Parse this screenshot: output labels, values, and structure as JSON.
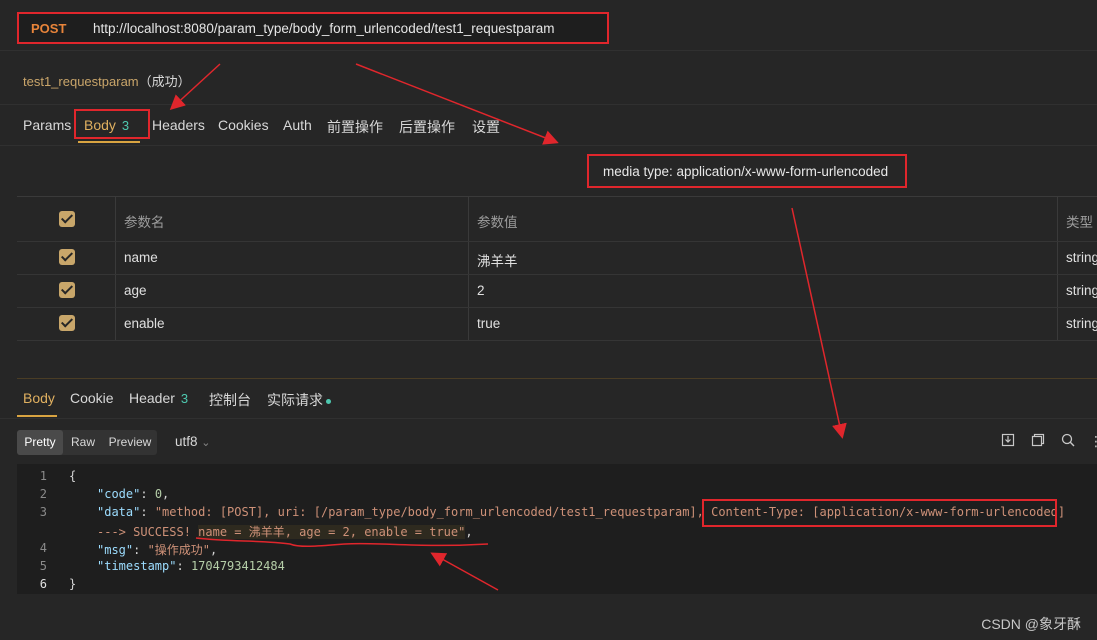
{
  "request": {
    "method": "POST",
    "url": "http://localhost:8080/param_type/body_form_urlencoded/test1_requestparam",
    "name": "test1_requestparam",
    "status": "（成功）"
  },
  "tabs": [
    {
      "label": "Params"
    },
    {
      "label": "Body",
      "count": "3"
    },
    {
      "label": "Headers"
    },
    {
      "label": "Cookies"
    },
    {
      "label": "Auth"
    },
    {
      "label": "前置操作"
    },
    {
      "label": "后置操作"
    },
    {
      "label": "设置"
    }
  ],
  "media_type": "media type: application/x-www-form-urlencoded",
  "params": {
    "headers": [
      "参数名",
      "参数值",
      "类型"
    ],
    "rows": [
      {
        "name": "name",
        "value": "沸羊羊",
        "type": "string"
      },
      {
        "name": "age",
        "value": "2",
        "type": "string"
      },
      {
        "name": "enable",
        "value": "true",
        "type": "string"
      }
    ]
  },
  "response_tabs": [
    {
      "label": "Body"
    },
    {
      "label": "Cookie"
    },
    {
      "label": "Header",
      "count": "3"
    },
    {
      "label": "控制台"
    },
    {
      "label": "实际请求"
    }
  ],
  "view_modes": [
    "Pretty",
    "Raw",
    "Preview"
  ],
  "encoding": "utf8",
  "code": {
    "line_numbers": [
      "1",
      "2",
      "3",
      "",
      "4",
      "5",
      "6"
    ],
    "l1": "{",
    "code_key": "\"code\"",
    "code_val": "0",
    "data_key": "\"data\"",
    "data_val_a": "\"method: [POST], uri: [/param_type/body_form_urlencoded/test1_requestparam], ",
    "data_val_b": "Content-Type: [application/x-www-form-urlencoded]",
    "data_val_c": "---> SUCCESS! ",
    "data_val_d": "name = 沸羊羊, age = 2, enable = true\"",
    "msg_key": "\"msg\"",
    "msg_val": "\"操作成功\"",
    "ts_key": "\"timestamp\"",
    "ts_val": "1704793412484",
    "l_end": "}"
  },
  "watermark": "CSDN @象牙酥",
  "icons": [
    "download-icon",
    "copy-icon",
    "search-icon",
    "more-icon",
    "chevron-down-icon",
    "checkbox-icon"
  ]
}
